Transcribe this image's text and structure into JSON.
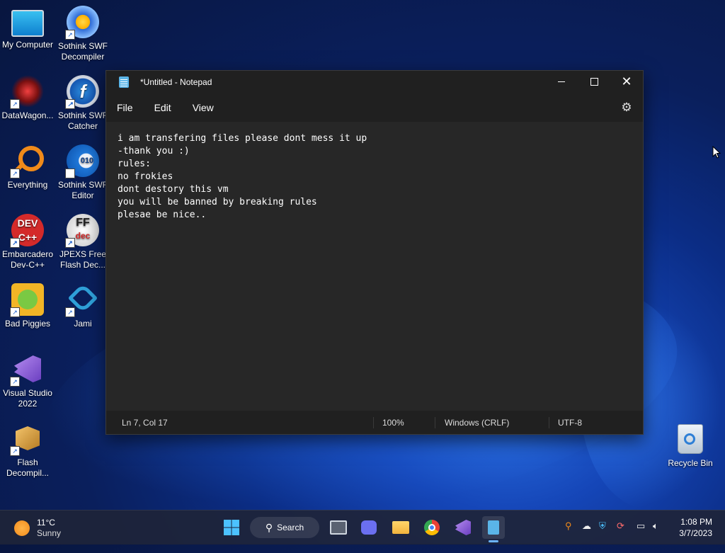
{
  "desktop": {
    "icons": [
      {
        "label": "My Computer",
        "icon": "monitor-icon"
      },
      {
        "label": "Sothink SWF Decompiler",
        "icon": "sothink-decompiler-icon"
      },
      {
        "label": "DataWagon...",
        "icon": "datawagon-icon"
      },
      {
        "label": "Sothink SWF Catcher",
        "icon": "sothink-catcher-icon"
      },
      {
        "label": "Everything",
        "icon": "magnifier-icon"
      },
      {
        "label": "Sothink SWF Editor",
        "icon": "sothink-editor-icon"
      },
      {
        "label": "Embarcadero Dev-C++",
        "icon": "devcpp-icon"
      },
      {
        "label": "JPEXS Free Flash Dec...",
        "icon": "jpexs-icon"
      },
      {
        "label": "Bad Piggies",
        "icon": "bad-piggies-icon"
      },
      {
        "label": "Jami",
        "icon": "jami-icon"
      },
      {
        "label": "Visual Studio 2022",
        "icon": "visual-studio-icon"
      },
      {
        "label": "Flash Decompil...",
        "icon": "flash-decompiler-icon"
      }
    ],
    "recycle_bin": {
      "label": "Recycle Bin"
    }
  },
  "notepad": {
    "title": "*Untitled - Notepad",
    "menu": [
      "File",
      "Edit",
      "View"
    ],
    "content": "i am transfering files please dont mess it up\n-thank you :)\nrules:\nno frokies\ndont destory this vm\nyou will be banned by breaking rules\nplesae be nice..",
    "status": {
      "position": "Ln 7, Col 17",
      "zoom": "100%",
      "line_ending": "Windows (CRLF)",
      "encoding": "UTF-8"
    }
  },
  "taskbar": {
    "weather": {
      "temp": "11°C",
      "condition": "Sunny"
    },
    "search_label": "Search",
    "clock": {
      "time": "1:08 PM",
      "date": "3/7/2023"
    }
  },
  "colors": {
    "window_bg": "#202020",
    "editor_bg": "#272727",
    "accent": "#6cb4ff"
  }
}
